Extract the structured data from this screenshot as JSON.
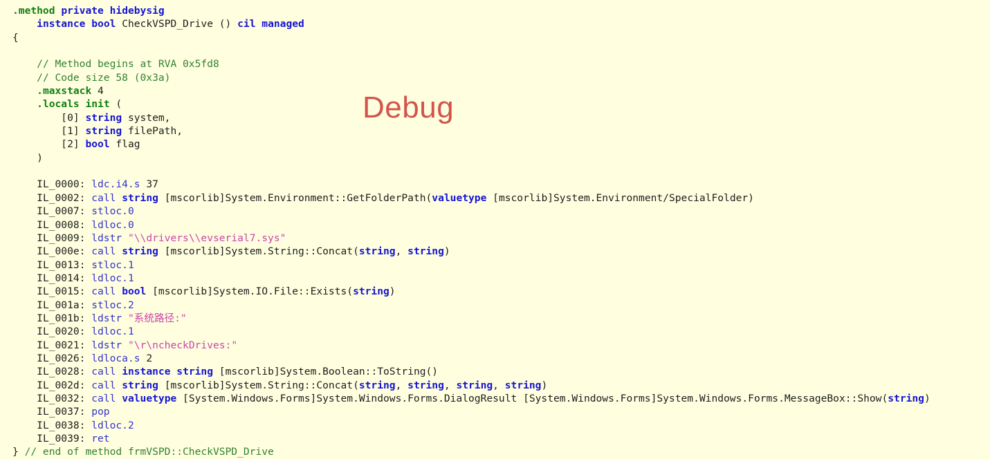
{
  "view": {
    "name": "il-disassembly-view",
    "background_color": "#ffffe0",
    "default_text_color": "#1c1c1c"
  },
  "watermark": {
    "text": "Debug",
    "color": "#d2544c"
  },
  "palette": {
    "directive": "#108010",
    "keyword": "#1414d2",
    "opcode": "#3333cc",
    "comment": "#318031",
    "string": "#cc44aa",
    "plain": "#1c1c1c"
  },
  "code": {
    "method_signature": ".method private hidebysig instance bool CheckVSPD_Drive () cil managed",
    "method_name": "CheckVSPD_Drive",
    "declaring_type": "frmVSPD",
    "rva": "0x5fd8",
    "code_size": "58 (0x3a)",
    "maxstack": "4",
    "locals": [
      {
        "index": "[0]",
        "type": "string",
        "name": "system,"
      },
      {
        "index": "[1]",
        "type": "string",
        "name": "filePath,"
      },
      {
        "index": "[2]",
        "type": "bool",
        "name": "flag"
      }
    ],
    "lines": [
      {
        "id": "line-0",
        "indent": 0,
        "tokens": [
          {
            "t": "directive",
            "v": ".method"
          },
          {
            "t": "plain",
            "v": " "
          },
          {
            "t": "keyword",
            "v": "private"
          },
          {
            "t": "plain",
            "v": " "
          },
          {
            "t": "keyword",
            "v": "hidebysig"
          }
        ]
      },
      {
        "id": "line-1",
        "indent": 1,
        "tokens": [
          {
            "t": "keyword",
            "v": "instance"
          },
          {
            "t": "plain",
            "v": " "
          },
          {
            "t": "keyword",
            "v": "bool"
          },
          {
            "t": "plain",
            "v": " CheckVSPD_Drive () "
          },
          {
            "t": "keyword",
            "v": "cil"
          },
          {
            "t": "plain",
            "v": " "
          },
          {
            "t": "keyword",
            "v": "managed"
          }
        ]
      },
      {
        "id": "line-2",
        "indent": 0,
        "tokens": [
          {
            "t": "brace",
            "v": "{"
          }
        ]
      },
      {
        "id": "line-3",
        "indent": 0,
        "tokens": [
          {
            "t": "plain",
            "v": ""
          }
        ]
      },
      {
        "id": "line-4",
        "indent": 1,
        "tokens": [
          {
            "t": "comment",
            "v": "// Method begins at RVA 0x5fd8"
          }
        ]
      },
      {
        "id": "line-5",
        "indent": 1,
        "tokens": [
          {
            "t": "comment",
            "v": "// Code size 58 (0x3a)"
          }
        ]
      },
      {
        "id": "line-6",
        "indent": 1,
        "tokens": [
          {
            "t": "directive",
            "v": ".maxstack"
          },
          {
            "t": "number",
            "v": " 4"
          }
        ]
      },
      {
        "id": "line-7",
        "indent": 1,
        "tokens": [
          {
            "t": "directive",
            "v": ".locals"
          },
          {
            "t": "plain",
            "v": " "
          },
          {
            "t": "directive",
            "v": "init"
          },
          {
            "t": "plain",
            "v": " "
          },
          {
            "t": "brace",
            "v": "("
          }
        ]
      },
      {
        "id": "line-8",
        "indent": 2,
        "tokens": [
          {
            "t": "plain",
            "v": "[0] "
          },
          {
            "t": "keyword",
            "v": "string"
          },
          {
            "t": "plain",
            "v": " system,"
          }
        ]
      },
      {
        "id": "line-9",
        "indent": 2,
        "tokens": [
          {
            "t": "plain",
            "v": "[1] "
          },
          {
            "t": "keyword",
            "v": "string"
          },
          {
            "t": "plain",
            "v": " filePath,"
          }
        ]
      },
      {
        "id": "line-10",
        "indent": 2,
        "tokens": [
          {
            "t": "plain",
            "v": "[2] "
          },
          {
            "t": "keyword",
            "v": "bool"
          },
          {
            "t": "plain",
            "v": " flag"
          }
        ]
      },
      {
        "id": "line-11",
        "indent": 1,
        "tokens": [
          {
            "t": "brace",
            "v": ")"
          }
        ]
      },
      {
        "id": "line-12",
        "indent": 0,
        "tokens": [
          {
            "t": "plain",
            "v": ""
          }
        ]
      },
      {
        "id": "line-13",
        "indent": 1,
        "tokens": [
          {
            "t": "label",
            "v": "IL_0000: "
          },
          {
            "t": "opcode",
            "v": "ldc.i4.s"
          },
          {
            "t": "number",
            "v": " 37"
          }
        ]
      },
      {
        "id": "line-14",
        "indent": 1,
        "tokens": [
          {
            "t": "label",
            "v": "IL_0002: "
          },
          {
            "t": "opcode",
            "v": "call"
          },
          {
            "t": "plain",
            "v": " "
          },
          {
            "t": "keyword",
            "v": "string"
          },
          {
            "t": "plain",
            "v": " [mscorlib]System.Environment::GetFolderPath("
          },
          {
            "t": "keyword",
            "v": "valuetype"
          },
          {
            "t": "plain",
            "v": " [mscorlib]System.Environment/SpecialFolder)"
          }
        ]
      },
      {
        "id": "line-15",
        "indent": 1,
        "tokens": [
          {
            "t": "label",
            "v": "IL_0007: "
          },
          {
            "t": "opcode",
            "v": "stloc.0"
          }
        ]
      },
      {
        "id": "line-16",
        "indent": 1,
        "tokens": [
          {
            "t": "label",
            "v": "IL_0008: "
          },
          {
            "t": "opcode",
            "v": "ldloc.0"
          }
        ]
      },
      {
        "id": "line-17",
        "indent": 1,
        "tokens": [
          {
            "t": "label",
            "v": "IL_0009: "
          },
          {
            "t": "opcode",
            "v": "ldstr"
          },
          {
            "t": "plain",
            "v": " "
          },
          {
            "t": "string",
            "v": "\"\\\\drivers\\\\evserial7.sys\""
          }
        ]
      },
      {
        "id": "line-18",
        "indent": 1,
        "tokens": [
          {
            "t": "label",
            "v": "IL_000e: "
          },
          {
            "t": "opcode",
            "v": "call"
          },
          {
            "t": "plain",
            "v": " "
          },
          {
            "t": "keyword",
            "v": "string"
          },
          {
            "t": "plain",
            "v": " [mscorlib]System.String::Concat("
          },
          {
            "t": "keyword",
            "v": "string"
          },
          {
            "t": "plain",
            "v": ", "
          },
          {
            "t": "keyword",
            "v": "string"
          },
          {
            "t": "plain",
            "v": ")"
          }
        ]
      },
      {
        "id": "line-19",
        "indent": 1,
        "tokens": [
          {
            "t": "label",
            "v": "IL_0013: "
          },
          {
            "t": "opcode",
            "v": "stloc.1"
          }
        ]
      },
      {
        "id": "line-20",
        "indent": 1,
        "tokens": [
          {
            "t": "label",
            "v": "IL_0014: "
          },
          {
            "t": "opcode",
            "v": "ldloc.1"
          }
        ]
      },
      {
        "id": "line-21",
        "indent": 1,
        "tokens": [
          {
            "t": "label",
            "v": "IL_0015: "
          },
          {
            "t": "opcode",
            "v": "call"
          },
          {
            "t": "plain",
            "v": " "
          },
          {
            "t": "keyword",
            "v": "bool"
          },
          {
            "t": "plain",
            "v": " [mscorlib]System.IO.File::Exists("
          },
          {
            "t": "keyword",
            "v": "string"
          },
          {
            "t": "plain",
            "v": ")"
          }
        ]
      },
      {
        "id": "line-22",
        "indent": 1,
        "tokens": [
          {
            "t": "label",
            "v": "IL_001a: "
          },
          {
            "t": "opcode",
            "v": "stloc.2"
          }
        ]
      },
      {
        "id": "line-23",
        "indent": 1,
        "tokens": [
          {
            "t": "label",
            "v": "IL_001b: "
          },
          {
            "t": "opcode",
            "v": "ldstr"
          },
          {
            "t": "plain",
            "v": " "
          },
          {
            "t": "string",
            "v": "\"系统路径:\""
          }
        ]
      },
      {
        "id": "line-24",
        "indent": 1,
        "tokens": [
          {
            "t": "label",
            "v": "IL_0020: "
          },
          {
            "t": "opcode",
            "v": "ldloc.1"
          }
        ]
      },
      {
        "id": "line-25",
        "indent": 1,
        "tokens": [
          {
            "t": "label",
            "v": "IL_0021: "
          },
          {
            "t": "opcode",
            "v": "ldstr"
          },
          {
            "t": "plain",
            "v": " "
          },
          {
            "t": "string",
            "v": "\"\\r\\ncheckDrives:\""
          }
        ]
      },
      {
        "id": "line-26",
        "indent": 1,
        "tokens": [
          {
            "t": "label",
            "v": "IL_0026: "
          },
          {
            "t": "opcode",
            "v": "ldloca.s"
          },
          {
            "t": "number",
            "v": " 2"
          }
        ]
      },
      {
        "id": "line-27",
        "indent": 1,
        "tokens": [
          {
            "t": "label",
            "v": "IL_0028: "
          },
          {
            "t": "opcode",
            "v": "call"
          },
          {
            "t": "plain",
            "v": " "
          },
          {
            "t": "keyword",
            "v": "instance"
          },
          {
            "t": "plain",
            "v": " "
          },
          {
            "t": "keyword",
            "v": "string"
          },
          {
            "t": "plain",
            "v": " [mscorlib]System.Boolean::ToString()"
          }
        ]
      },
      {
        "id": "line-28",
        "indent": 1,
        "tokens": [
          {
            "t": "label",
            "v": "IL_002d: "
          },
          {
            "t": "opcode",
            "v": "call"
          },
          {
            "t": "plain",
            "v": " "
          },
          {
            "t": "keyword",
            "v": "string"
          },
          {
            "t": "plain",
            "v": " [mscorlib]System.String::Concat("
          },
          {
            "t": "keyword",
            "v": "string"
          },
          {
            "t": "plain",
            "v": ", "
          },
          {
            "t": "keyword",
            "v": "string"
          },
          {
            "t": "plain",
            "v": ", "
          },
          {
            "t": "keyword",
            "v": "string"
          },
          {
            "t": "plain",
            "v": ", "
          },
          {
            "t": "keyword",
            "v": "string"
          },
          {
            "t": "plain",
            "v": ")"
          }
        ]
      },
      {
        "id": "line-29",
        "indent": 1,
        "tokens": [
          {
            "t": "label",
            "v": "IL_0032: "
          },
          {
            "t": "opcode",
            "v": "call"
          },
          {
            "t": "plain",
            "v": " "
          },
          {
            "t": "keyword",
            "v": "valuetype"
          },
          {
            "t": "plain",
            "v": " [System.Windows.Forms]System.Windows.Forms.DialogResult [System.Windows.Forms]System.Windows.Forms.MessageBox::Show("
          },
          {
            "t": "keyword",
            "v": "string"
          },
          {
            "t": "plain",
            "v": ")"
          }
        ]
      },
      {
        "id": "line-30",
        "indent": 1,
        "tokens": [
          {
            "t": "label",
            "v": "IL_0037: "
          },
          {
            "t": "opcode",
            "v": "pop"
          }
        ]
      },
      {
        "id": "line-31",
        "indent": 1,
        "tokens": [
          {
            "t": "label",
            "v": "IL_0038: "
          },
          {
            "t": "opcode",
            "v": "ldloc.2"
          }
        ]
      },
      {
        "id": "line-32",
        "indent": 1,
        "tokens": [
          {
            "t": "label",
            "v": "IL_0039: "
          },
          {
            "t": "opcode",
            "v": "ret"
          }
        ]
      },
      {
        "id": "line-33",
        "indent": 0,
        "tokens": [
          {
            "t": "brace",
            "v": "} "
          },
          {
            "t": "comment",
            "v": "// end of method frmVSPD::CheckVSPD_Drive"
          }
        ]
      }
    ]
  }
}
